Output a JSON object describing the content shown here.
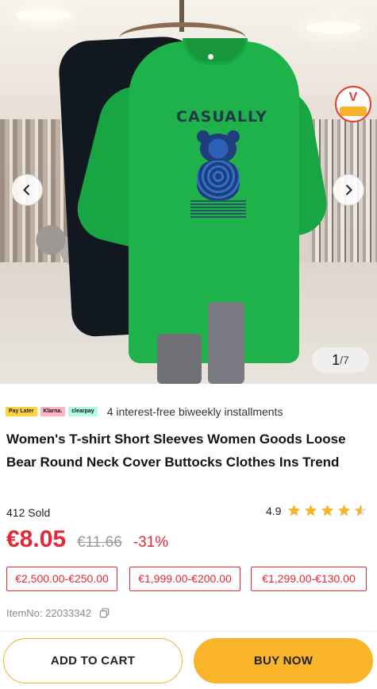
{
  "gallery": {
    "current": "1",
    "total": "/7",
    "print_text": "CASUALLY",
    "badge_text": "V"
  },
  "payments": {
    "logos": [
      "Pay Later",
      "Klarna.",
      "clearpay"
    ],
    "installment_text": "4 interest-free biweekly installments"
  },
  "product": {
    "title": "Women's T-shirt Short Sleeves Women Goods Loose Bear Round Neck Cover Buttocks Clothes Ins Trend",
    "sold": "412 Sold",
    "rating": "4.9",
    "rating_stars": 4.9,
    "price": "€8.05",
    "original_price": "€11.66",
    "discount": "-31%",
    "coupons": [
      "€2,500.00-€250.00",
      "€1,999.00-€200.00",
      "€1,299.00-€130.00"
    ],
    "item_no": "ItemNo: 22033342"
  },
  "actions": {
    "add_to_cart": "ADD TO CART",
    "buy_now": "BUY NOW"
  },
  "colors": {
    "price_red": "#e4283a",
    "star_yellow": "#f6b52b",
    "buy_button": "#f9b42a",
    "shirt_green": "#1fb24a"
  },
  "icons": {
    "prev": "chevron-left-icon",
    "next": "chevron-right-icon",
    "copy": "copy-icon",
    "star": "star-icon"
  }
}
